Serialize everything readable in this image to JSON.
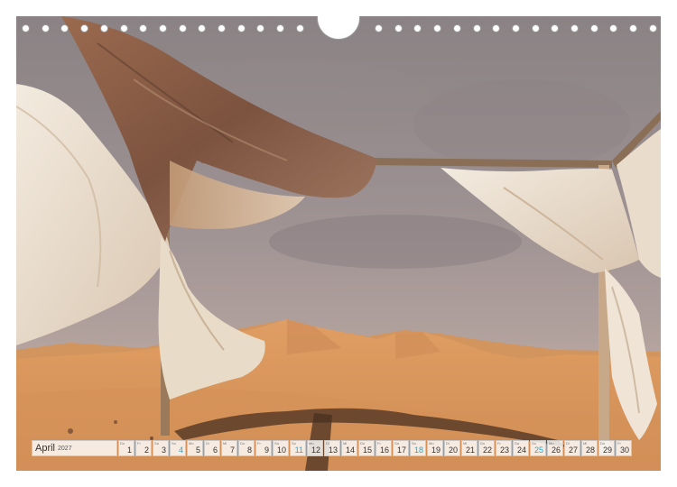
{
  "calendar": {
    "month": "April",
    "year": "2027",
    "days": [
      {
        "wd": "Do",
        "day": "1",
        "sunday": false
      },
      {
        "wd": "Fr",
        "day": "2",
        "sunday": false
      },
      {
        "wd": "Sa",
        "day": "3",
        "sunday": false
      },
      {
        "wd": "So",
        "day": "4",
        "sunday": true
      },
      {
        "wd": "Mo",
        "day": "5",
        "sunday": false
      },
      {
        "wd": "Di",
        "day": "6",
        "sunday": false
      },
      {
        "wd": "Mi",
        "day": "7",
        "sunday": false
      },
      {
        "wd": "Do",
        "day": "8",
        "sunday": false
      },
      {
        "wd": "Fr",
        "day": "9",
        "sunday": false
      },
      {
        "wd": "Sa",
        "day": "10",
        "sunday": false
      },
      {
        "wd": "So",
        "day": "11",
        "sunday": true
      },
      {
        "wd": "Mo",
        "day": "12",
        "sunday": false
      },
      {
        "wd": "Di",
        "day": "13",
        "sunday": false
      },
      {
        "wd": "Mi",
        "day": "14",
        "sunday": false
      },
      {
        "wd": "Do",
        "day": "15",
        "sunday": false
      },
      {
        "wd": "Fr",
        "day": "16",
        "sunday": false
      },
      {
        "wd": "Sa",
        "day": "17",
        "sunday": false
      },
      {
        "wd": "So",
        "day": "18",
        "sunday": true
      },
      {
        "wd": "Mo",
        "day": "19",
        "sunday": false
      },
      {
        "wd": "Di",
        "day": "20",
        "sunday": false
      },
      {
        "wd": "Mi",
        "day": "21",
        "sunday": false
      },
      {
        "wd": "Do",
        "day": "22",
        "sunday": false
      },
      {
        "wd": "Fr",
        "day": "23",
        "sunday": false
      },
      {
        "wd": "Sa",
        "day": "24",
        "sunday": false
      },
      {
        "wd": "So",
        "day": "25",
        "sunday": true
      },
      {
        "wd": "Mo",
        "day": "26",
        "sunday": false
      },
      {
        "wd": "Di",
        "day": "27",
        "sunday": false
      },
      {
        "wd": "Mi",
        "day": "28",
        "sunday": false
      },
      {
        "wd": "Do",
        "day": "29",
        "sunday": false
      },
      {
        "wd": "Fr",
        "day": "30",
        "sunday": false
      }
    ]
  },
  "colors": {
    "sky_top": "#8f8688",
    "sky_bottom": "#b7aaa6",
    "sand": "#d99a61",
    "sand_dark": "#c4804a",
    "fabric_brown": "#8a5c44",
    "fabric_cream": "#eee2d2",
    "wood": "#8b6e56",
    "sunday_text": "#2aa6c9"
  },
  "icons": {
    "binding_hole": "binding-hole-icon",
    "hanger_notch": "hanger-notch-icon"
  }
}
